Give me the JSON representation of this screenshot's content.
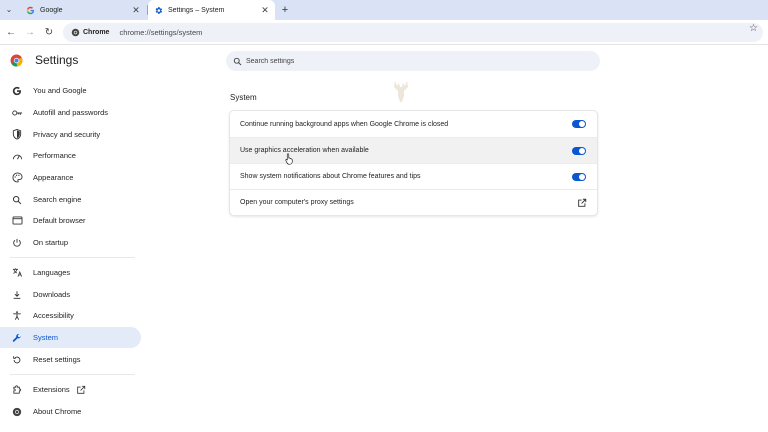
{
  "browser": {
    "tabs": [
      {
        "title": "Google",
        "favicon": "google-g-icon",
        "active": false
      },
      {
        "title": "Settings – System",
        "favicon": "gear-icon",
        "active": true
      }
    ],
    "chip_label": "Chrome",
    "url": "chrome://settings/system"
  },
  "sidebar": {
    "title": "Settings",
    "items": [
      {
        "label": "You and Google",
        "icon": "google-g-icon"
      },
      {
        "label": "Autofill and passwords",
        "icon": "key-icon"
      },
      {
        "label": "Privacy and security",
        "icon": "shield-icon"
      },
      {
        "label": "Performance",
        "icon": "speedometer-icon"
      },
      {
        "label": "Appearance",
        "icon": "palette-icon"
      },
      {
        "label": "Search engine",
        "icon": "search-icon"
      },
      {
        "label": "Default browser",
        "icon": "browser-window-icon"
      },
      {
        "label": "On startup",
        "icon": "power-icon"
      },
      {
        "label": "Languages",
        "icon": "translate-icon"
      },
      {
        "label": "Downloads",
        "icon": "download-icon"
      },
      {
        "label": "Accessibility",
        "icon": "accessibility-icon"
      },
      {
        "label": "System",
        "icon": "wrench-icon",
        "selected": true
      },
      {
        "label": "Reset settings",
        "icon": "reset-icon"
      },
      {
        "label": "Extensions",
        "icon": "puzzle-icon"
      },
      {
        "label": "About Chrome",
        "icon": "chrome-logo-icon"
      }
    ]
  },
  "search": {
    "placeholder": "Search settings"
  },
  "main": {
    "section_title": "System",
    "rows": [
      {
        "label": "Continue running background apps when Google Chrome is closed",
        "control": "toggle",
        "checked": true
      },
      {
        "label": "Use graphics acceleration when available",
        "control": "toggle",
        "checked": true
      },
      {
        "label": "Show system notifications about Chrome features and tips",
        "control": "toggle",
        "checked": true
      },
      {
        "label": "Open your computer's proxy settings",
        "control": "external-link"
      }
    ]
  },
  "colors": {
    "accent": "#0b57d0",
    "tabstrip": "#d9e3f5",
    "selected_nav": "#e3eaf8"
  }
}
